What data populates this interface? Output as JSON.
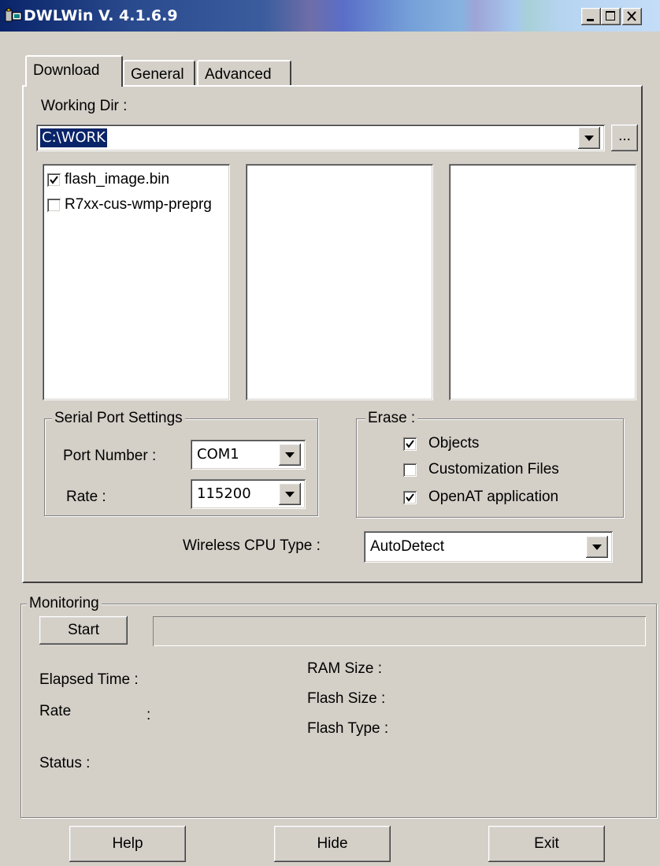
{
  "window": {
    "title": "DWLWin V. 4.1.6.9"
  },
  "tabs": [
    {
      "label": "Download"
    },
    {
      "label": "General"
    },
    {
      "label": "Advanced"
    }
  ],
  "download": {
    "working_dir_label": "Working Dir :",
    "working_dir_value": "C:\\WORK",
    "browse_label": "...",
    "files": [
      {
        "name": "flash_image.bin",
        "checked": true
      },
      {
        "name": "R7xx-cus-wmp-preprg",
        "checked": false
      }
    ]
  },
  "serial": {
    "legend": "Serial Port Settings",
    "port_label": "Port Number :",
    "port_value": "COM1",
    "rate_label": "Rate :",
    "rate_value": "115200"
  },
  "erase": {
    "legend": "Erase :",
    "options": [
      {
        "label": "Objects",
        "checked": true
      },
      {
        "label": "Customization Files",
        "checked": false
      },
      {
        "label": "OpenAT application",
        "checked": true
      }
    ]
  },
  "cpu": {
    "label": "Wireless CPU Type :",
    "value": "AutoDetect"
  },
  "monitoring": {
    "legend": "Monitoring",
    "start_label": "Start",
    "elapsed_label": "Elapsed Time :",
    "rate_label": "Rate",
    "rate_colon": ":",
    "status_label": "Status :",
    "ram_label": "RAM Size  :",
    "flash_size_label": "Flash Size  :",
    "flash_type_label": "Flash Type :"
  },
  "footer": {
    "help_label": "Help",
    "hide_label": "Hide",
    "exit_label": "Exit"
  }
}
